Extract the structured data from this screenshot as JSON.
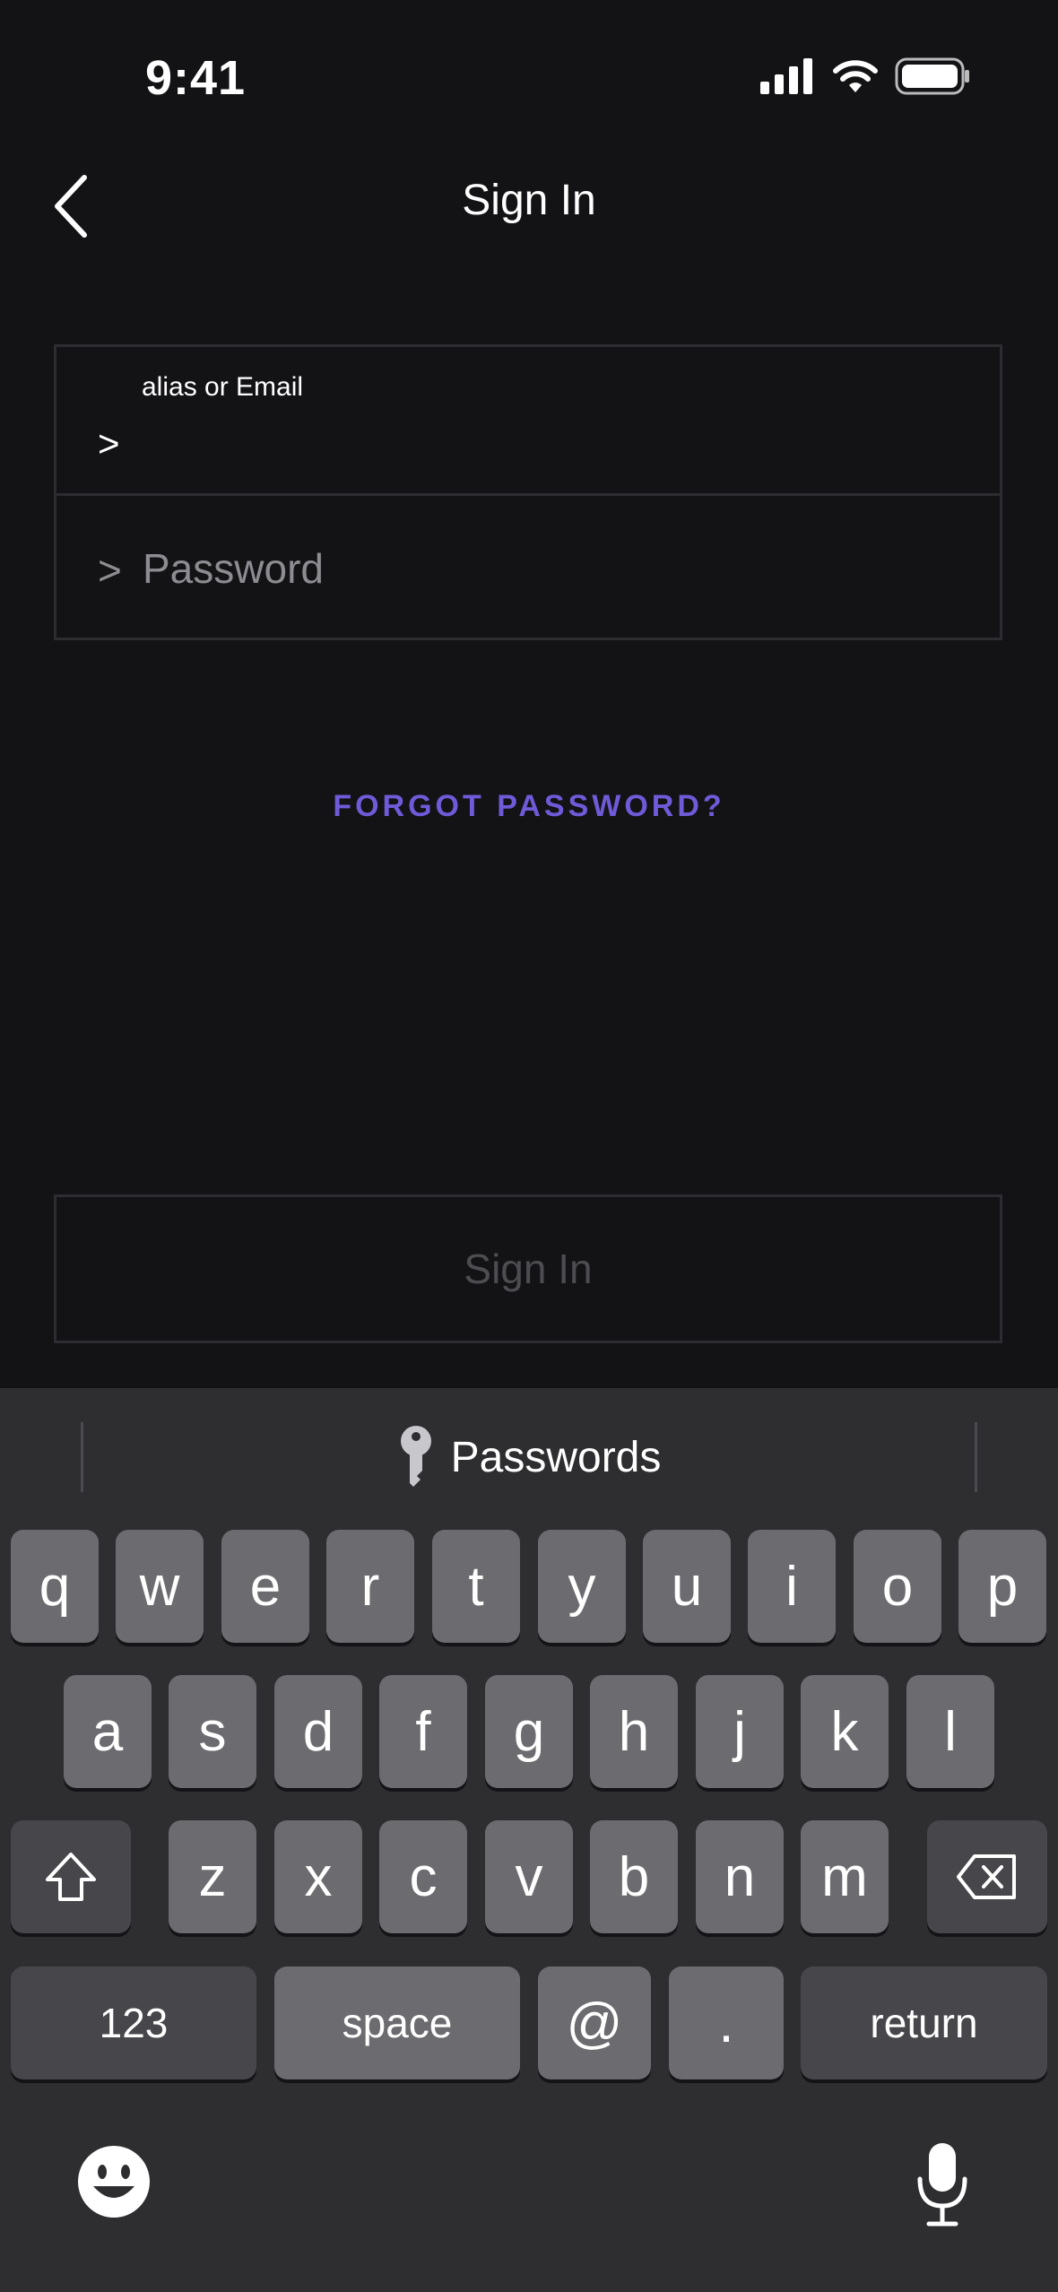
{
  "status_bar": {
    "time": "9:41"
  },
  "nav": {
    "title": "Sign In"
  },
  "form": {
    "email_label": "alias or Email",
    "email_prompt": ">",
    "password_prompt": ">",
    "password_placeholder": "Password"
  },
  "forgot_password": "FORGOT PASSWORD?",
  "sign_in_button": "Sign In",
  "keyboard": {
    "suggestion": "Passwords",
    "row1": [
      "q",
      "w",
      "e",
      "r",
      "t",
      "y",
      "u",
      "i",
      "o",
      "p"
    ],
    "row2": [
      "a",
      "s",
      "d",
      "f",
      "g",
      "h",
      "j",
      "k",
      "l"
    ],
    "row3": [
      "z",
      "x",
      "c",
      "v",
      "b",
      "n",
      "m"
    ],
    "numbers_key": "123",
    "space_key": "space",
    "at_key": "@",
    "dot_key": ".",
    "return_key": "return"
  }
}
